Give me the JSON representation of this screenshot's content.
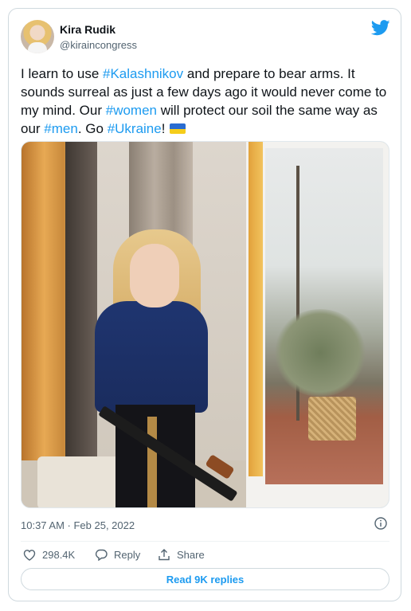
{
  "author": {
    "name": "Kira Rudik",
    "handle": "@kiraincongress"
  },
  "tweet": {
    "segments": [
      {
        "text": "I learn to use ",
        "tag": false
      },
      {
        "text": "#Kalashnikov",
        "tag": true
      },
      {
        "text": " and prepare to bear arms. It sounds surreal as just a few days ago it would never come to my mind. Our ",
        "tag": false
      },
      {
        "text": "#women",
        "tag": true
      },
      {
        "text": " will protect our soil the same way as our ",
        "tag": false
      },
      {
        "text": "#men",
        "tag": true
      },
      {
        "text": ". Go ",
        "tag": false
      },
      {
        "text": "#Ukraine",
        "tag": true
      },
      {
        "text": "!",
        "tag": false
      }
    ],
    "emoji": "ukraine-flag-emoji"
  },
  "timestamp": "10:37 AM · Feb 25, 2022",
  "actions": {
    "likes": "298.4K",
    "reply_label": "Reply",
    "share_label": "Share"
  },
  "read_replies_label": "Read 9K replies",
  "colors": {
    "accent": "#1d9bf0",
    "muted": "#536471",
    "border": "#cfd9de",
    "like": "#536471"
  },
  "icons": {
    "brand": "twitter-bird-icon",
    "info": "info-icon",
    "like": "heart-icon",
    "reply": "reply-icon",
    "share": "share-icon"
  }
}
